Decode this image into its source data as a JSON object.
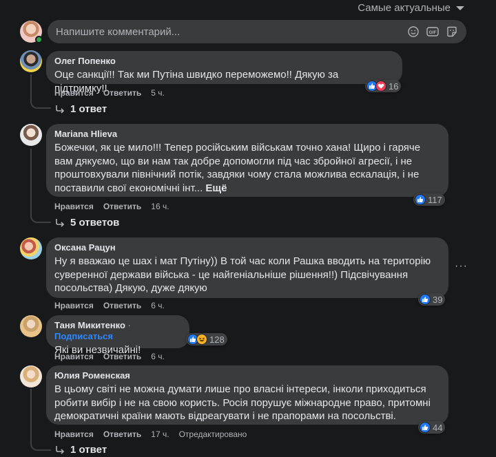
{
  "sort": {
    "label": "Самые актуальные"
  },
  "composer": {
    "placeholder": "Напишите комментарий..."
  },
  "labels": {
    "like": "Нравится",
    "reply": "Ответить",
    "more": "Ещё"
  },
  "comments": [
    {
      "author": "Олег Попенко",
      "text": "Оце санкції!! Так ми Путіна швидко переможемо!! Дякую за підтримку!!",
      "time": "5 ч.",
      "reactions": [
        "like-icon",
        "love-icon"
      ],
      "reaction_count": "16",
      "replies": "1 ответ"
    },
    {
      "author": "Mariana Hlieva",
      "text": "Божечки, як це мило!!! Тепер російським військам точно хана! Щиро і гаряче вам дякуємо, що ви нам так добре допомогли під час збройної агресії, і не проштовхували північний потік, завдяки чому стала можлива ескалація, і не поставили свої економічні інт...",
      "time": "16 ч.",
      "reactions": [
        "like-icon"
      ],
      "reaction_count": "117",
      "replies": "5 ответов"
    },
    {
      "author": "Оксана Рацун",
      "text": "Ну я вважаю це шах і мат Путіну)) В той час коли Рашка вводить на територію суверенної держави війська - це найгеніальніше рішення!!) Підсвічування посольства) Дякую, дуже дякую",
      "time": "6 ч.",
      "reactions": [
        "like-icon"
      ],
      "reaction_count": "39"
    },
    {
      "author": "Таня Микитенко",
      "separator": "·",
      "subscribe": "Подписаться",
      "text": "Які ви незвичайні!",
      "time": "6 ч.",
      "reactions": [
        "like-icon",
        "haha-icon"
      ],
      "reaction_count": "128"
    },
    {
      "author": "Юлия Роменская",
      "text": "В цьому світі не можна думати лише про власні інтереси, інколи приходиться робити вибір і не на свою користь. Росія порушує міжнародне право, притомні демократичні країни мають відреагувати і не прапорами на посольстві.",
      "time": "17 ч.",
      "edited": "Отредактировано",
      "reactions": [
        "like-icon"
      ],
      "reaction_count": "44",
      "replies": "1 ответ"
    }
  ]
}
